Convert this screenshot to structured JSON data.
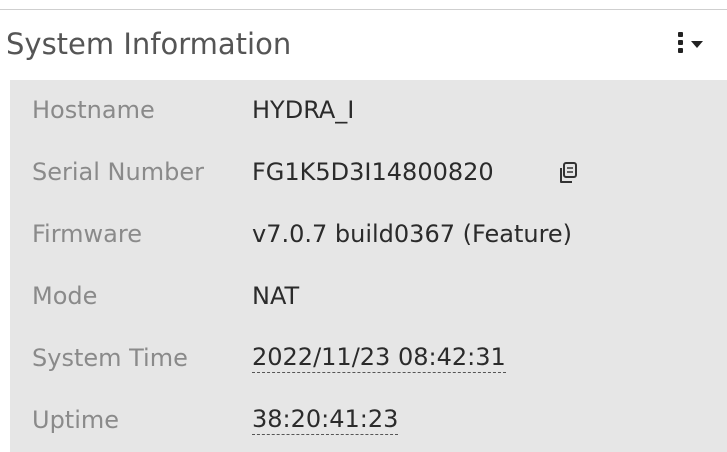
{
  "widget": {
    "title": "System Information"
  },
  "rows": [
    {
      "label": "Hostname",
      "value": "HYDRA_I"
    },
    {
      "label": "Serial Number",
      "value": "FG1K5D3I14800820"
    },
    {
      "label": "Firmware",
      "value": "v7.0.7 build0367 (Feature)"
    },
    {
      "label": "Mode",
      "value": "NAT"
    },
    {
      "label": "System Time",
      "value": "2022/11/23 08:42:31"
    },
    {
      "label": "Uptime",
      "value": "38:20:41:23"
    }
  ],
  "icons": {
    "menu": "vertical-ellipsis-dropdown-icon",
    "copy": "copy-icon"
  },
  "colors": {
    "panel_background": "#e6e6e6",
    "label_text": "#8a8a8a",
    "value_text": "#2b2b2b",
    "title_text": "#555555"
  }
}
